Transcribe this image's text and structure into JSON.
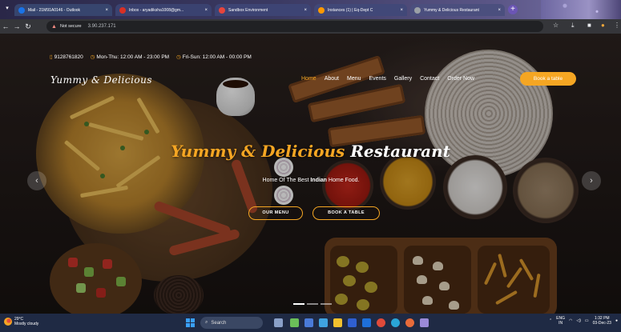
{
  "browser": {
    "tabs": [
      {
        "label": "Mail - 21M91A0146 - Outlook",
        "color": "#1a73e8"
      },
      {
        "label": "Inbox - aryadiksha1008@gm...",
        "color": "#d93025"
      },
      {
        "label": "Sandbox Environment",
        "color": "#e8453c"
      },
      {
        "label": "Instances (1) | Eq-Dept C",
        "color": "#ff9900"
      },
      {
        "label": "Yummy & Delicious Restaurant",
        "color": "#9aa0a6"
      }
    ],
    "security_label": "Not secure",
    "url": "3.90.237.171"
  },
  "site": {
    "phone": "9128761820",
    "hours_weekday": "Mon-Thu: 12:00 AM - 23:00 PM",
    "hours_weekend": "Fri-Sun: 12:00 AM - 00:00 PM",
    "logo": "Yummy & Delicious",
    "nav": [
      "Home",
      "About",
      "Menu",
      "Events",
      "Gallery",
      "Contact",
      "Order Now"
    ],
    "book_button": "Book a table",
    "accent": "#f5a623"
  },
  "hero": {
    "title_accent": "Yummy & Delicious",
    "title_white": "Restaurant",
    "sub_before": "Home Of The Best",
    "sub_bold": "Indian",
    "sub_after": "Home Food.",
    "btn_menu": "OUR MENU",
    "btn_book": "BOOK A TABLE",
    "arrow_prev": "‹",
    "arrow_next": "›"
  },
  "taskbar": {
    "temperature": "29°C",
    "weather": "Mostly cloudy",
    "search": "Search",
    "lang1": "ENG",
    "lang2": "IN",
    "time": "1:32 PM",
    "date": "03-Dec-23"
  }
}
